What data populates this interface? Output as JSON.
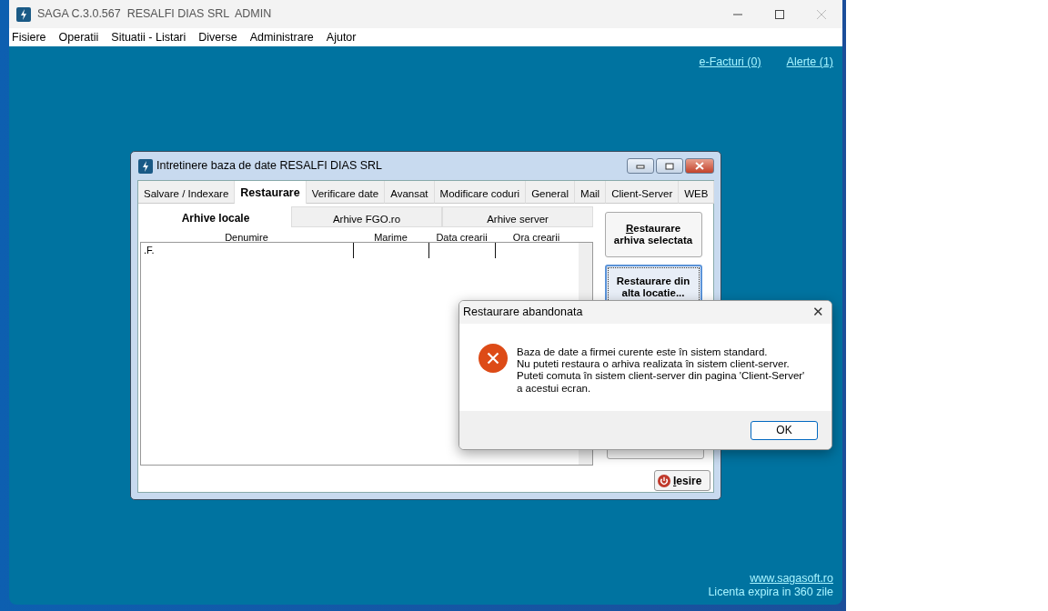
{
  "app_window": {
    "title": "SAGA C.3.0.567  RESALFI DIAS SRL  ADMIN"
  },
  "menu": [
    {
      "label": "Fisiere"
    },
    {
      "label": "Operatii"
    },
    {
      "label": "Situatii - Listari"
    },
    {
      "label": "Diverse"
    },
    {
      "label": "Administrare"
    },
    {
      "label": "Ajutor"
    }
  ],
  "header_links": [
    {
      "label": "e-Facturi (0)"
    },
    {
      "label": "Alerte (1)"
    }
  ],
  "maintenance_window": {
    "title": "Intretinere baza de date RESALFI DIAS SRL",
    "tabs": [
      {
        "label": "Salvare / Indexare",
        "selected": false
      },
      {
        "label": "Restaurare",
        "selected": true
      },
      {
        "label": "Verificare date",
        "selected": false
      },
      {
        "label": "Avansat",
        "selected": false
      },
      {
        "label": "Modificare coduri",
        "selected": false
      },
      {
        "label": "General",
        "selected": false
      },
      {
        "label": "Mail",
        "selected": false
      },
      {
        "label": "Client-Server",
        "selected": false
      },
      {
        "label": "WEB",
        "selected": false
      }
    ],
    "subtabs": [
      {
        "label": "Arhive locale",
        "selected": true
      },
      {
        "label": "Arhive FGO.ro",
        "selected": false
      },
      {
        "label": "Arhive server",
        "selected": false
      }
    ],
    "columns": [
      "Denumire",
      "Marime",
      "Data crearii",
      "Ora crearii"
    ],
    "rows": [
      {
        "denumire": ".F."
      }
    ],
    "buttons": [
      {
        "label": "Restaurare arhiva selectata",
        "focused": false
      },
      {
        "label": "Restaurare din alta locatie...",
        "focused": true
      }
    ],
    "exit_button": "Iesire"
  },
  "dialog": {
    "title": "Restaurare abandonata",
    "close": "✕",
    "lines": [
      "Baza de date a firmei curente este în sistem standard.",
      "Nu puteti restaura o arhiva realizata în sistem client-server.",
      "Puteti comuta în sistem client-server din pagina 'Client-Server'",
      "a acestui ecran."
    ],
    "ok_button": "OK"
  },
  "footer": {
    "link": "www.sagasoft.ro",
    "license": "Licenta expira in 360 zile"
  }
}
